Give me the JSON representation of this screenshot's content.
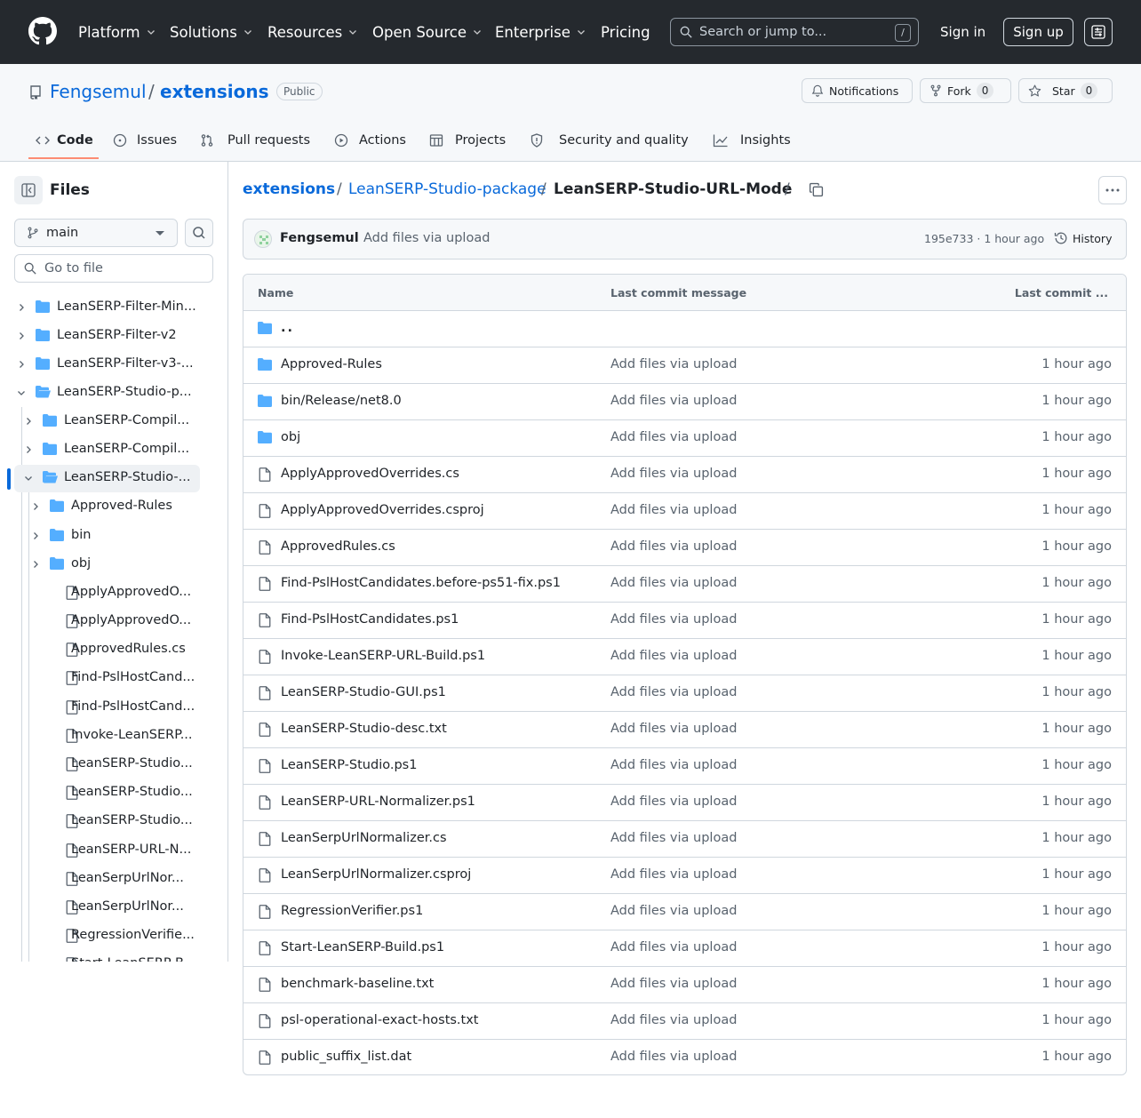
{
  "header": {
    "nav": [
      {
        "label": "Platform",
        "dropdown": true
      },
      {
        "label": "Solutions",
        "dropdown": true
      },
      {
        "label": "Resources",
        "dropdown": true
      },
      {
        "label": "Open Source",
        "dropdown": true
      },
      {
        "label": "Enterprise",
        "dropdown": true
      },
      {
        "label": "Pricing",
        "dropdown": false
      }
    ],
    "search_placeholder": "Search or jump to...",
    "search_shortcut": "/",
    "sign_in": "Sign in",
    "sign_up": "Sign up"
  },
  "repo": {
    "owner": "Fengsemul",
    "separator": "/",
    "name": "extensions",
    "visibility": "Public",
    "notifications_label": "Notifications",
    "fork_label": "Fork",
    "fork_count": "0",
    "star_label": "Star",
    "star_count": "0",
    "tabs": [
      {
        "label": "Code",
        "icon": "code-icon",
        "active": true
      },
      {
        "label": "Issues",
        "icon": "issue-icon"
      },
      {
        "label": "Pull requests",
        "icon": "pull-request-icon"
      },
      {
        "label": "Actions",
        "icon": "play-icon"
      },
      {
        "label": "Projects",
        "icon": "table-icon"
      },
      {
        "label": "Security and quality",
        "icon": "shield-icon"
      },
      {
        "label": "Insights",
        "icon": "graph-icon"
      }
    ]
  },
  "sidebar": {
    "title": "Files",
    "branch": "main",
    "goto_placeholder": "Go to file",
    "tree": [
      {
        "label": "LeanSERP-Filter-Min...",
        "type": "folder",
        "level": 0,
        "expanded": false
      },
      {
        "label": "LeanSERP-Filter-v2",
        "type": "folder",
        "level": 0,
        "expanded": false
      },
      {
        "label": "LeanSERP-Filter-v3-...",
        "type": "folder",
        "level": 0,
        "expanded": false
      },
      {
        "label": "LeanSERP-Studio-p...",
        "type": "folder-open",
        "level": 0,
        "expanded": true
      },
      {
        "label": "LeanSERP-Compil...",
        "type": "folder",
        "level": 1,
        "expanded": false
      },
      {
        "label": "LeanSERP-Compil...",
        "type": "folder",
        "level": 1,
        "expanded": false
      },
      {
        "label": "LeanSERP-Studio-...",
        "type": "folder-open",
        "level": 1,
        "expanded": true,
        "selected": true
      },
      {
        "label": "Approved-Rules",
        "type": "folder",
        "level": 2,
        "expanded": false
      },
      {
        "label": "bin",
        "type": "folder",
        "level": 2,
        "expanded": false
      },
      {
        "label": "obj",
        "type": "folder",
        "level": 2,
        "expanded": false
      },
      {
        "label": "ApplyApprovedO...",
        "type": "file",
        "level": 2
      },
      {
        "label": "ApplyApprovedO...",
        "type": "file",
        "level": 2
      },
      {
        "label": "ApprovedRules.cs",
        "type": "file",
        "level": 2
      },
      {
        "label": "Find-PslHostCand...",
        "type": "file",
        "level": 2
      },
      {
        "label": "Find-PslHostCand...",
        "type": "file",
        "level": 2
      },
      {
        "label": "Invoke-LeanSERP...",
        "type": "file",
        "level": 2
      },
      {
        "label": "LeanSERP-Studio...",
        "type": "file",
        "level": 2
      },
      {
        "label": "LeanSERP-Studio...",
        "type": "file",
        "level": 2
      },
      {
        "label": "LeanSERP-Studio...",
        "type": "file",
        "level": 2
      },
      {
        "label": "LeanSERP-URL-N...",
        "type": "file",
        "level": 2
      },
      {
        "label": "LeanSerpUrlNor...",
        "type": "file",
        "level": 2
      },
      {
        "label": "LeanSerpUrlNor...",
        "type": "file",
        "level": 2
      },
      {
        "label": "RegressionVerifie...",
        "type": "file",
        "level": 2
      },
      {
        "label": "Start-LeanSERP-B...",
        "type": "file",
        "level": 2
      }
    ]
  },
  "breadcrumb": {
    "root": "extensions",
    "middle": "LeanSERP-Studio-package",
    "current": "LeanSERP-Studio-URL-Mode",
    "sep": "/"
  },
  "commit": {
    "author": "Fengsemul",
    "message": "Add files via upload",
    "sha_time": "195e733 · 1 hour ago",
    "history": "History"
  },
  "table": {
    "headers": {
      "name": "Name",
      "message": "Last commit message",
      "date": "Last commit ..."
    },
    "parent": "..",
    "rows": [
      {
        "name": "Approved-Rules",
        "type": "folder",
        "message": "Add files via upload",
        "date": "1 hour ago"
      },
      {
        "name": "bin/Release/net8.0",
        "type": "folder",
        "message": "Add files via upload",
        "date": "1 hour ago"
      },
      {
        "name": "obj",
        "type": "folder",
        "message": "Add files via upload",
        "date": "1 hour ago"
      },
      {
        "name": "ApplyApprovedOverrides.cs",
        "type": "file",
        "message": "Add files via upload",
        "date": "1 hour ago"
      },
      {
        "name": "ApplyApprovedOverrides.csproj",
        "type": "file",
        "message": "Add files via upload",
        "date": "1 hour ago"
      },
      {
        "name": "ApprovedRules.cs",
        "type": "file",
        "message": "Add files via upload",
        "date": "1 hour ago"
      },
      {
        "name": "Find-PslHostCandidates.before-ps51-fix.ps1",
        "type": "file",
        "message": "Add files via upload",
        "date": "1 hour ago"
      },
      {
        "name": "Find-PslHostCandidates.ps1",
        "type": "file",
        "message": "Add files via upload",
        "date": "1 hour ago"
      },
      {
        "name": "Invoke-LeanSERP-URL-Build.ps1",
        "type": "file",
        "message": "Add files via upload",
        "date": "1 hour ago"
      },
      {
        "name": "LeanSERP-Studio-GUI.ps1",
        "type": "file",
        "message": "Add files via upload",
        "date": "1 hour ago"
      },
      {
        "name": "LeanSERP-Studio-desc.txt",
        "type": "file",
        "message": "Add files via upload",
        "date": "1 hour ago"
      },
      {
        "name": "LeanSERP-Studio.ps1",
        "type": "file",
        "message": "Add files via upload",
        "date": "1 hour ago"
      },
      {
        "name": "LeanSERP-URL-Normalizer.ps1",
        "type": "file",
        "message": "Add files via upload",
        "date": "1 hour ago"
      },
      {
        "name": "LeanSerpUrlNormalizer.cs",
        "type": "file",
        "message": "Add files via upload",
        "date": "1 hour ago"
      },
      {
        "name": "LeanSerpUrlNormalizer.csproj",
        "type": "file",
        "message": "Add files via upload",
        "date": "1 hour ago"
      },
      {
        "name": "RegressionVerifier.ps1",
        "type": "file",
        "message": "Add files via upload",
        "date": "1 hour ago"
      },
      {
        "name": "Start-LeanSERP-Build.ps1",
        "type": "file",
        "message": "Add files via upload",
        "date": "1 hour ago"
      },
      {
        "name": "benchmark-baseline.txt",
        "type": "file",
        "message": "Add files via upload",
        "date": "1 hour ago"
      },
      {
        "name": "psl-operational-exact-hosts.txt",
        "type": "file",
        "message": "Add files via upload",
        "date": "1 hour ago"
      },
      {
        "name": "public_suffix_list.dat",
        "type": "file",
        "message": "Add files via upload",
        "date": "1 hour ago"
      }
    ]
  },
  "colors": {
    "accent": "#0969da",
    "folder": "#54aeff",
    "header_bg": "#25292e",
    "active_tab_underline": "#fd8c73"
  }
}
